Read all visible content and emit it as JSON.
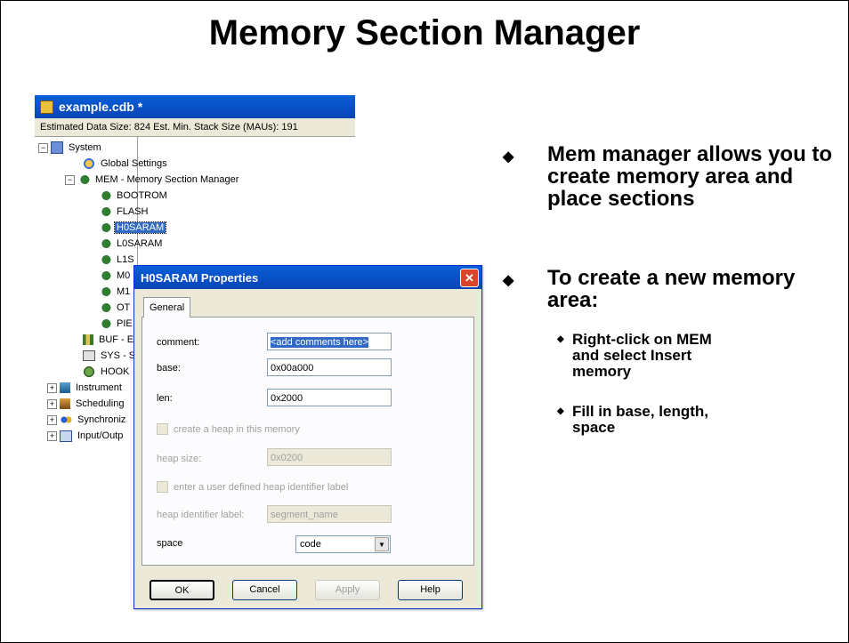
{
  "title": "Memory Section Manager",
  "tree_window": {
    "title": "example.cdb *",
    "status": "Estimated Data Size: 824   Est. Min. Stack Size (MAUs): 191",
    "nodes": [
      {
        "label": "System",
        "expander": "−",
        "icon": "system-icon"
      },
      {
        "label": "Global Settings",
        "icon": "globe-icon"
      },
      {
        "label": "MEM - Memory Section Manager",
        "expander": "−",
        "icon": "memory-chip-icon"
      },
      {
        "label": "BOOTROM",
        "icon": "memory-chip-icon"
      },
      {
        "label": "FLASH",
        "icon": "memory-chip-icon"
      },
      {
        "label": "H0SARAM",
        "icon": "memory-chip-icon",
        "selected": true
      },
      {
        "label": "L0SARAM",
        "icon": "memory-chip-icon"
      },
      {
        "label": "L1S",
        "icon": "memory-chip-icon"
      },
      {
        "label": "M0",
        "icon": "memory-chip-icon"
      },
      {
        "label": "M1",
        "icon": "memory-chip-icon"
      },
      {
        "label": "OT",
        "icon": "memory-chip-icon"
      },
      {
        "label": "PIE",
        "icon": "memory-chip-icon"
      },
      {
        "label": "BUF - E",
        "icon": "buffer-icon"
      },
      {
        "label": "SYS - S",
        "icon": "computer-icon"
      },
      {
        "label": "HOOK",
        "icon": "hook-icon"
      },
      {
        "label": "Instrument",
        "expander": "+",
        "icon": "instrument-icon"
      },
      {
        "label": "Scheduling",
        "expander": "+",
        "icon": "scheduling-icon"
      },
      {
        "label": "Synchroniz",
        "expander": "+",
        "icon": "sync-icon"
      },
      {
        "label": "Input/Outp",
        "expander": "+",
        "icon": "io-icon"
      }
    ]
  },
  "dialog": {
    "title": "H0SARAM Properties",
    "close_glyph": "✕",
    "tab": "General",
    "comment_label": "comment:",
    "comment_value": "<add comments here>",
    "base_label": "base:",
    "base_value": "0x00a000",
    "len_label": "len:",
    "len_value": "0x2000",
    "heap_checkbox_label": "create a heap in this memory",
    "heap_size_label": "heap size:",
    "heap_size_value": "0x0200",
    "heap_id_checkbox_label": "enter a user defined heap identifier label",
    "heap_id_label": "heap identifier label:",
    "heap_id_value": "segment_name",
    "space_label": "space",
    "space_value": "code",
    "buttons": {
      "ok": "OK",
      "cancel": "Cancel",
      "apply": "Apply",
      "help": "Help"
    }
  },
  "bullets": {
    "b1": "Mem manager allows you to create memory area and place sections",
    "b2": "To create a new memory area:",
    "s1": "Right-click on MEM and select Insert memory",
    "s2": "Fill in base, length, space",
    "mark_main": "◆",
    "mark_sub": "◆"
  }
}
